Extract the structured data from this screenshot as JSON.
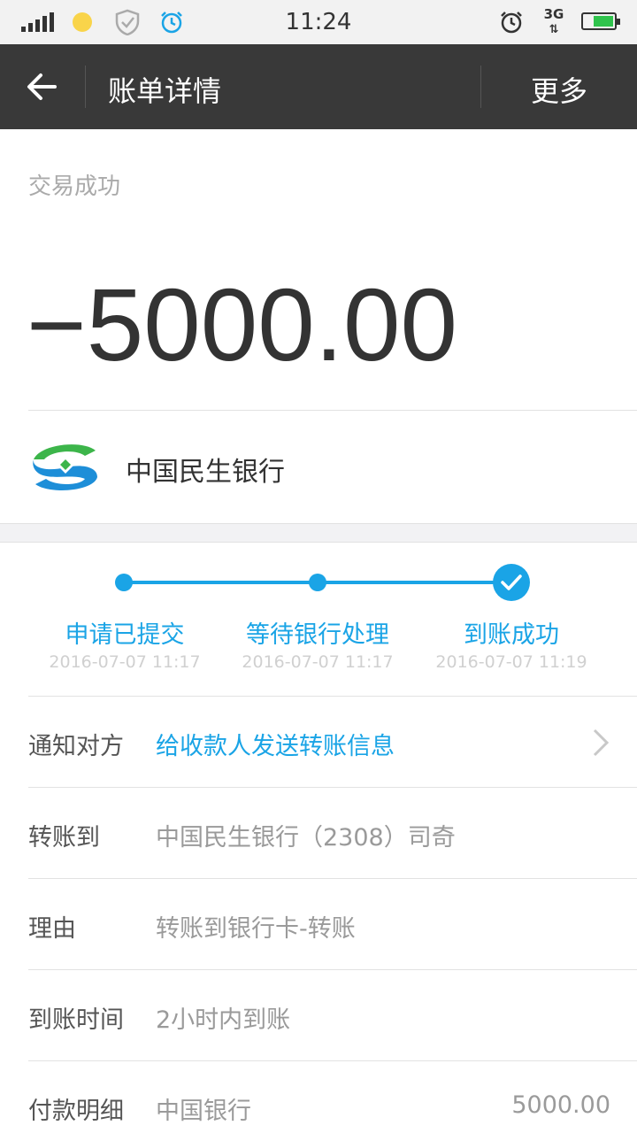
{
  "status_bar": {
    "time": "11:24",
    "network": "3G"
  },
  "nav": {
    "title": "账单详情",
    "more_label": "更多"
  },
  "header": {
    "status": "交易成功",
    "amount": "−5000.00",
    "bank_name": "中国民生银行"
  },
  "progress": {
    "steps": [
      {
        "label": "申请已提交",
        "time": "2016-07-07 11:17"
      },
      {
        "label": "等待银行处理",
        "time": "2016-07-07 11:17"
      },
      {
        "label": "到账成功",
        "time": "2016-07-07 11:19"
      }
    ]
  },
  "details": {
    "notify": {
      "label": "通知对方",
      "value": "给收款人发送转账信息"
    },
    "transfer_to": {
      "label": "转账到",
      "value": "中国民生银行（2308）司奇"
    },
    "reason": {
      "label": "理由",
      "value": "转账到银行卡-转账"
    },
    "arrival_time": {
      "label": "到账时间",
      "value": "2小时内到账"
    },
    "payment": {
      "label": "付款明细",
      "value": "中国银行",
      "amount": "5000.00"
    }
  },
  "colors": {
    "accent": "#1aa4e6",
    "nav_bg": "#393939",
    "logo_green": "#3cb54a",
    "logo_blue": "#1d8ed8"
  }
}
